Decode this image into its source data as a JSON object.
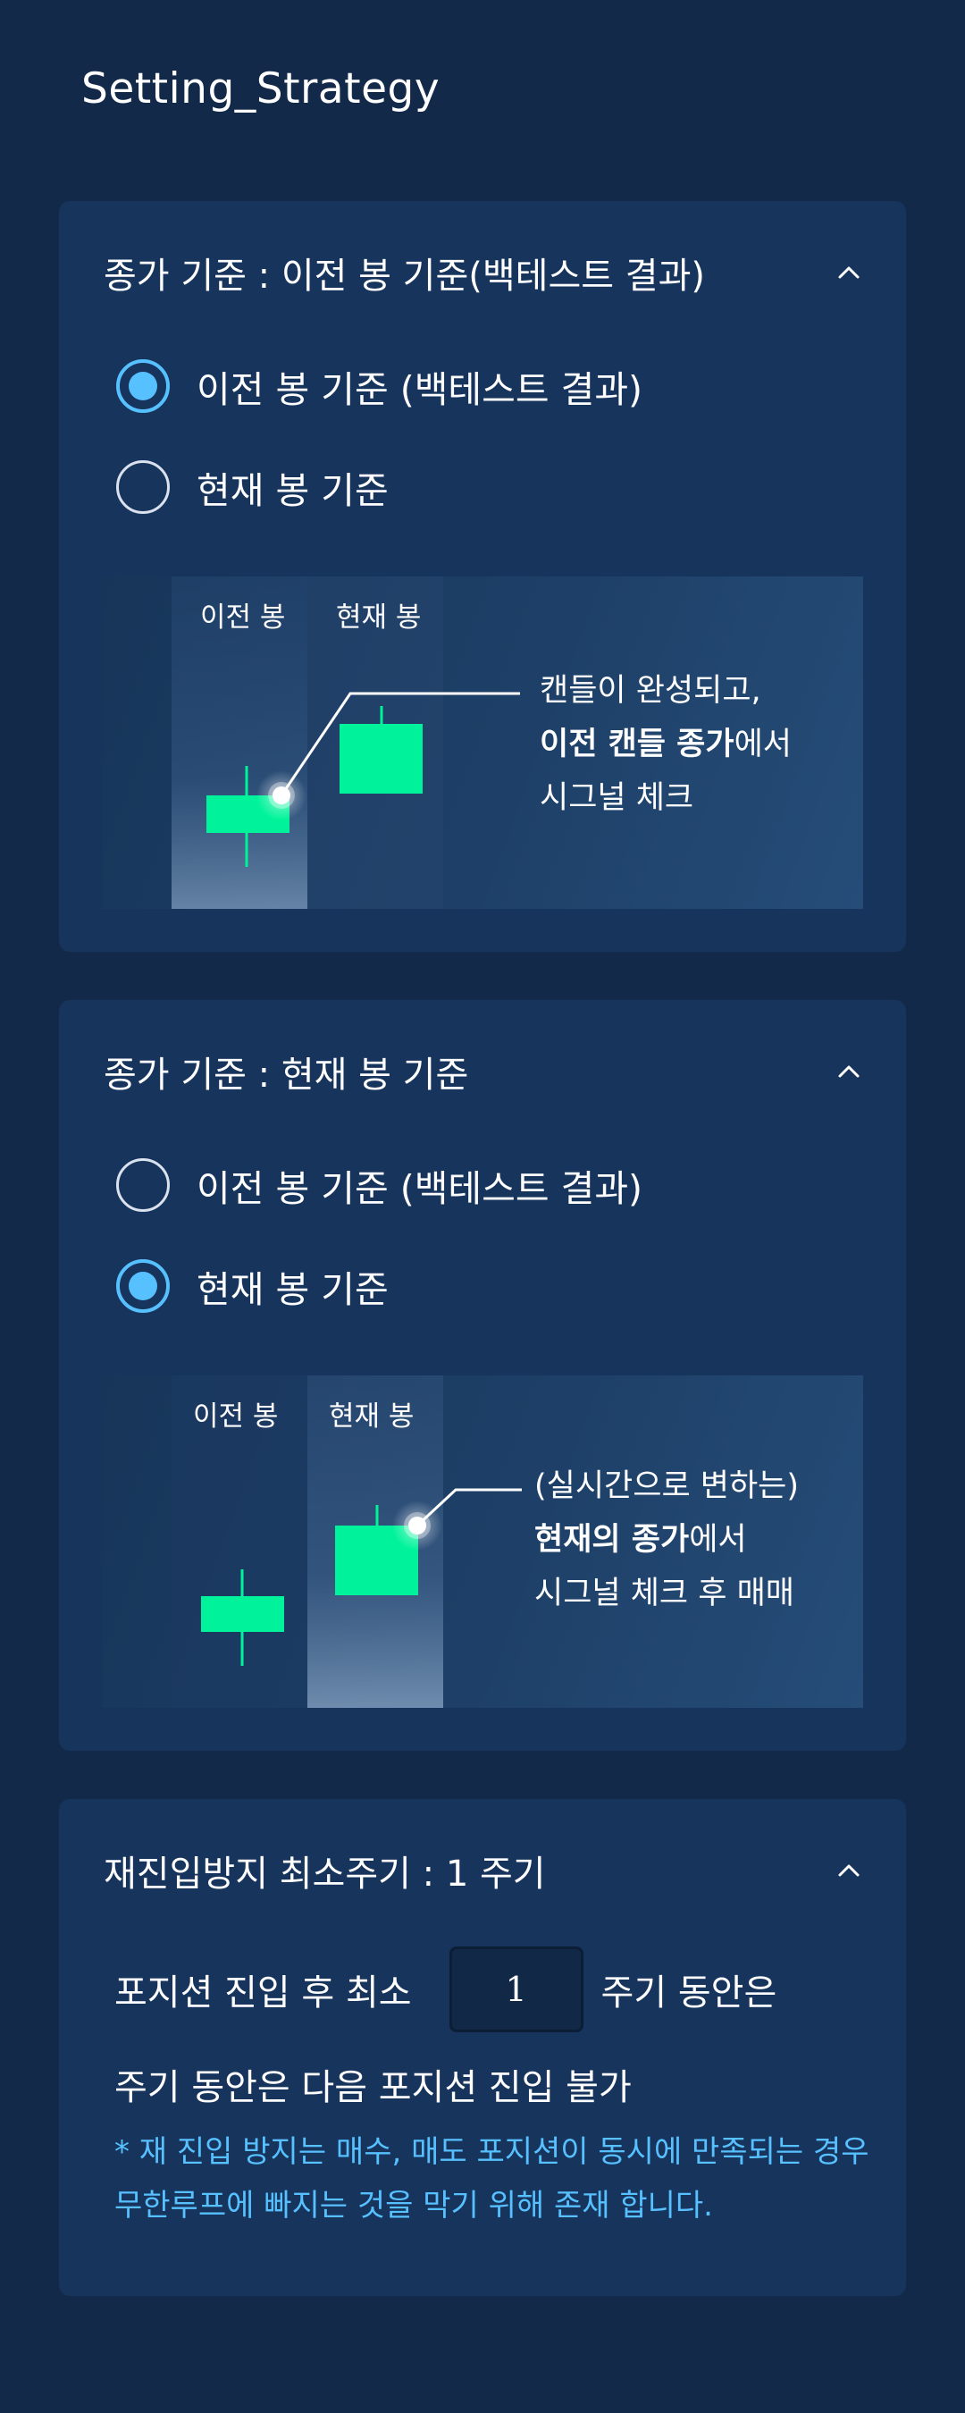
{
  "page_title": "Setting_Strategy",
  "colors": {
    "background": "#13294a",
    "card": "#17345c",
    "accent": "#57c0ff",
    "candle": "#00f39a"
  },
  "card1": {
    "title": "종가 기준 : 이전 봉 기준(백테스트 결과)",
    "chevron_icon": "chevron-up-icon",
    "options": [
      {
        "label": "이전 봉 기준 (백테스트 결과)",
        "selected": true
      },
      {
        "label": "현재 봉 기준",
        "selected": false
      }
    ],
    "illustration": {
      "prev_label": "이전 봉",
      "curr_label": "현재 봉",
      "desc_line1": "캔들이 완성되고,",
      "desc_bold": "이전 캔들 종가",
      "desc_line2_rest": "에서",
      "desc_line3": "시그널 체크"
    }
  },
  "card2": {
    "title": "종가 기준 : 현재 봉 기준",
    "chevron_icon": "chevron-up-icon",
    "options": [
      {
        "label": "이전 봉 기준 (백테스트 결과)",
        "selected": false
      },
      {
        "label": "현재 봉 기준",
        "selected": true
      }
    ],
    "illustration": {
      "prev_label": "이전 봉",
      "curr_label": "현재 봉",
      "desc_line1": "(실시간으로 변하는)",
      "desc_bold": "현재의 종가",
      "desc_line2_rest": "에서",
      "desc_line3": "시그널 체크 후 매매"
    }
  },
  "card3": {
    "title": "재진입방지 최소주기 : 1 주기",
    "chevron_icon": "chevron-up-icon",
    "line1_prefix": "포지션 진입 후 최소",
    "cycle_value": "1",
    "line1_suffix": "주기 동안은",
    "line2": "주기 동안은 다음 포지션 진입 불가",
    "note": "* 재 진입 방지는 매수, 매도 포지션이 동시에 만족되는 경우 무한루프에 빠지는 것을 막기 위해 존재 합니다."
  }
}
